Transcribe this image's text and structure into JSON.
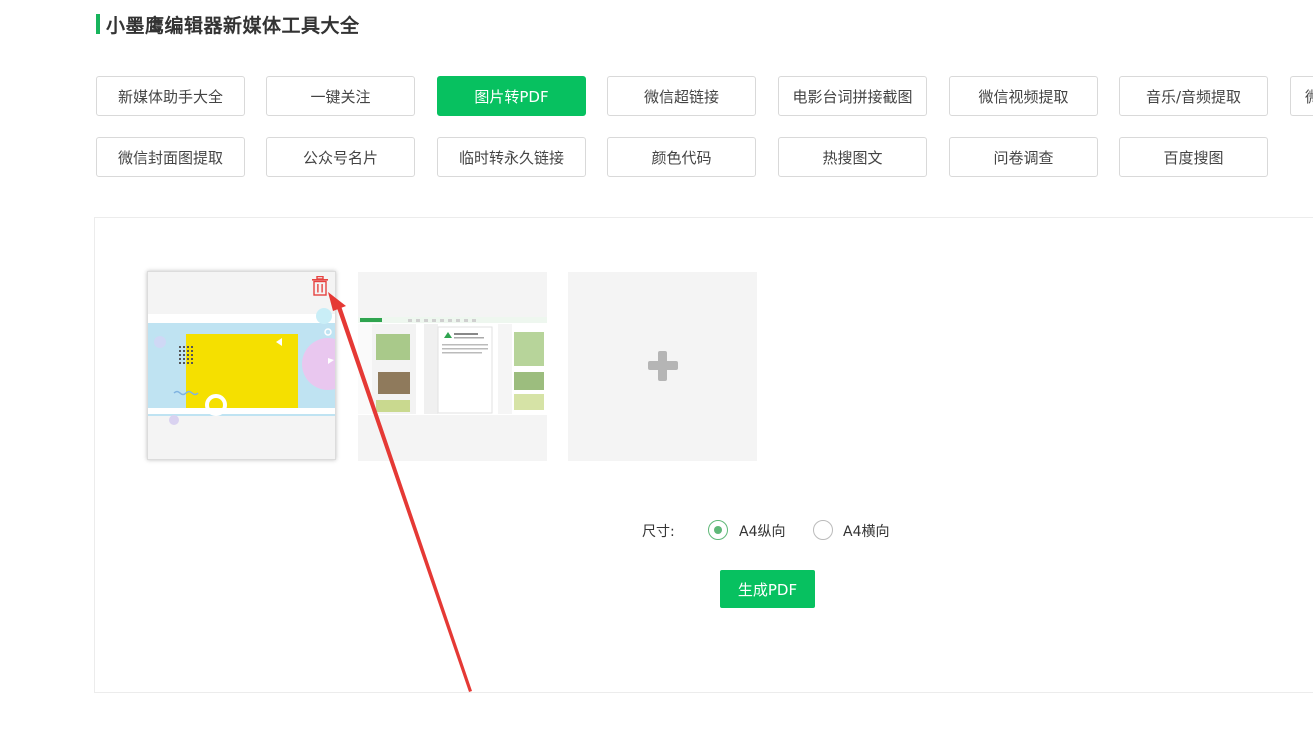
{
  "page": {
    "title": "小墨鹰编辑器新媒体工具大全"
  },
  "tools": {
    "row1": [
      "新媒体助手大全",
      "一键关注",
      "图片转PDF",
      "微信超链接",
      "电影台词拼接截图",
      "微信视频提取",
      "音乐/音频提取",
      "微"
    ],
    "row2": [
      "微信封面图提取",
      "公众号名片",
      "临时转永久链接",
      "颜色代码",
      "热搜图文",
      "问卷调查",
      "百度搜图"
    ],
    "active": "图片转PDF"
  },
  "converter": {
    "size_label": "尺寸:",
    "options": [
      "A4纵向",
      "A4横向"
    ],
    "selected_option": "A4纵向",
    "generate_label": "生成PDF"
  },
  "colors": {
    "accent": "#07c160",
    "radio": "#5fb878",
    "trash": "#e64340",
    "arrow": "#e53935"
  }
}
